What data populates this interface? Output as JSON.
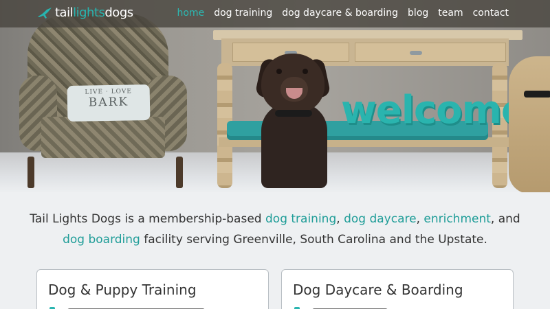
{
  "nav": {
    "logo": {
      "part1": "tail",
      "part2": "lights",
      "part3": "dogs"
    },
    "items": [
      {
        "label": "home",
        "active": true
      },
      {
        "label": "dog training",
        "active": false
      },
      {
        "label": "dog daycare & boarding",
        "active": false
      },
      {
        "label": "blog",
        "active": false
      },
      {
        "label": "team",
        "active": false
      },
      {
        "label": "contact",
        "active": false
      }
    ]
  },
  "hero": {
    "pillow_line1": "LIVE · LOVE",
    "pillow_line2": "BARK",
    "sign_text": "welcome"
  },
  "intro": {
    "t1": "Tail Lights Dogs is a membership-based ",
    "link1": "dog training",
    "t2": ", ",
    "link2": "dog daycare",
    "t3": ", ",
    "link3": "enrichment",
    "t4": ", and ",
    "link4": "dog boarding",
    "t5": " facility serving Greenville, South Carolina and the Upstate."
  },
  "cards": [
    {
      "title": "Dog & Puppy Training"
    },
    {
      "title": "Dog Daycare & Boarding"
    }
  ],
  "colors": {
    "accent": "#2bb5b0",
    "text": "#333333",
    "background": "#eef0f2"
  }
}
